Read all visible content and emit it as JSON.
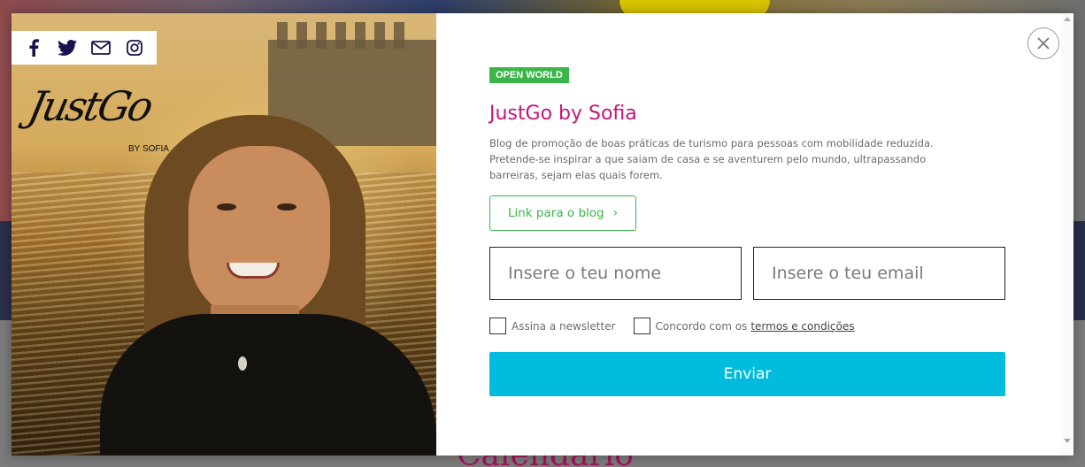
{
  "background": {
    "heading": "Calendário"
  },
  "modal": {
    "social_icons": [
      "facebook-icon",
      "twitter-icon",
      "email-icon",
      "instagram-icon"
    ],
    "logo": {
      "script": "JustGo",
      "sub": "BY SOFIA"
    },
    "badge": "OPEN WORLD",
    "title": "JustGo by Sofia",
    "description": "Blog de promoção de boas práticas de turismo para pessoas com mobilidade reduzida. Pretende-se inspirar a que saiam de casa e se aventurem pelo mundo, ultrapassando barreiras, sejam elas quais forem.",
    "blog_link_label": "Link para o blog",
    "name_placeholder": "Insere o teu nome",
    "email_placeholder": "Insere o teu email",
    "newsletter_label": "Assina a newsletter",
    "terms_prefix": "Concordo com os",
    "terms_link": "termos e condições",
    "submit_label": "Enviar",
    "colors": {
      "accent_green": "#3bb54a",
      "title_pink": "#c4167b",
      "submit_cyan": "#00bcdc"
    }
  }
}
